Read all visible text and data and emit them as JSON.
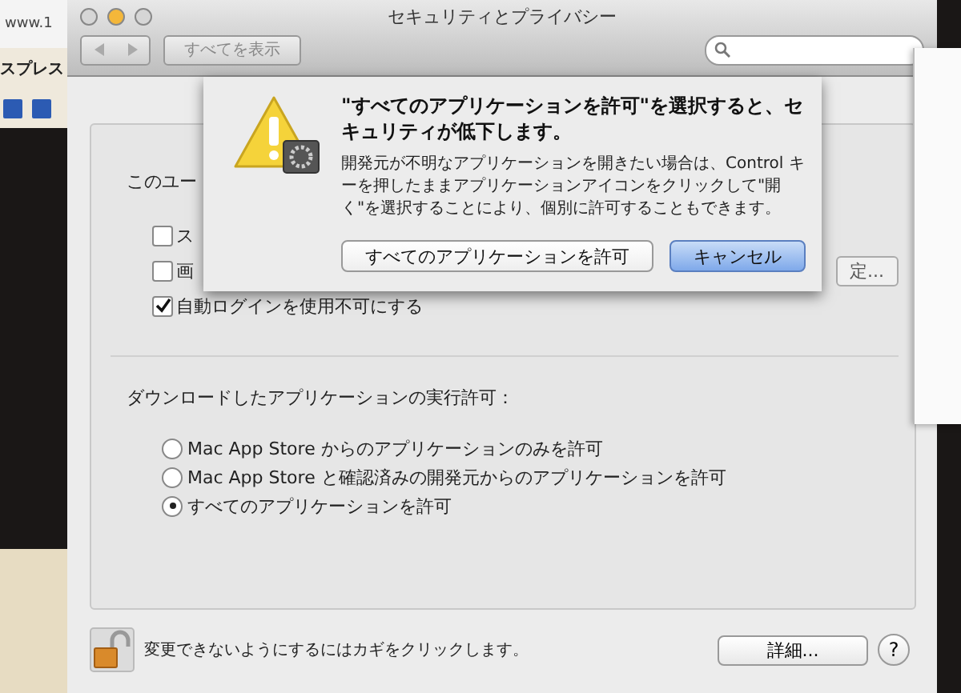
{
  "background_browser": {
    "address": "www.1",
    "heading": "スプレス"
  },
  "window": {
    "title": "セキュリティとプライバシー",
    "show_all_button": "すべてを表示"
  },
  "general": {
    "heading": "このユー",
    "checkboxes": [
      {
        "label": "ス",
        "checked": false
      },
      {
        "label": "画",
        "checked": false
      },
      {
        "label": "自動ログインを使用不可にする",
        "checked": true
      }
    ],
    "message_button": "定..."
  },
  "downloads": {
    "heading": "ダウンロードしたアプリケーションの実行許可：",
    "options": [
      {
        "label": "Mac App Store からのアプリケーションのみを許可",
        "selected": false
      },
      {
        "label": "Mac App Store と確認済みの開発元からのアプリケーションを許可",
        "selected": false
      },
      {
        "label": "すべてのアプリケーションを許可",
        "selected": true
      }
    ]
  },
  "footer": {
    "lock_text": "変更できないようにするにはカギをクリックします。",
    "advanced_button": "詳細...",
    "help_button": "?"
  },
  "alert": {
    "title": "\"すべてのアプリケーションを許可\"を選択すると、セキュリティが低下します。",
    "message": "開発元が不明なアプリケーションを開きたい場合は、Control キーを押したままアプリケーションアイコンをクリックして\"開く\"を選択することにより、個別に許可することもできます。",
    "buttons": [
      {
        "label": "すべてのアプリケーションを許可",
        "default": false
      },
      {
        "label": "キャンセル",
        "default": true
      }
    ]
  }
}
